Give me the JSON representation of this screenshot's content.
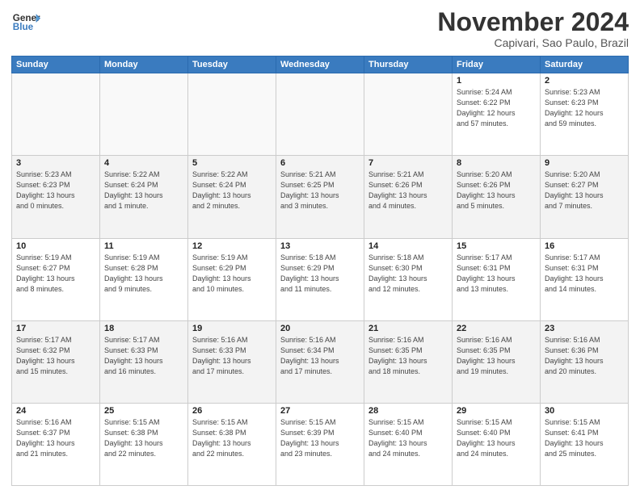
{
  "header": {
    "logo_line1": "General",
    "logo_line2": "Blue",
    "month": "November 2024",
    "location": "Capivari, Sao Paulo, Brazil"
  },
  "weekdays": [
    "Sunday",
    "Monday",
    "Tuesday",
    "Wednesday",
    "Thursday",
    "Friday",
    "Saturday"
  ],
  "weeks": [
    [
      {
        "day": "",
        "info": ""
      },
      {
        "day": "",
        "info": ""
      },
      {
        "day": "",
        "info": ""
      },
      {
        "day": "",
        "info": ""
      },
      {
        "day": "",
        "info": ""
      },
      {
        "day": "1",
        "info": "Sunrise: 5:24 AM\nSunset: 6:22 PM\nDaylight: 12 hours\nand 57 minutes."
      },
      {
        "day": "2",
        "info": "Sunrise: 5:23 AM\nSunset: 6:23 PM\nDaylight: 12 hours\nand 59 minutes."
      }
    ],
    [
      {
        "day": "3",
        "info": "Sunrise: 5:23 AM\nSunset: 6:23 PM\nDaylight: 13 hours\nand 0 minutes."
      },
      {
        "day": "4",
        "info": "Sunrise: 5:22 AM\nSunset: 6:24 PM\nDaylight: 13 hours\nand 1 minute."
      },
      {
        "day": "5",
        "info": "Sunrise: 5:22 AM\nSunset: 6:24 PM\nDaylight: 13 hours\nand 2 minutes."
      },
      {
        "day": "6",
        "info": "Sunrise: 5:21 AM\nSunset: 6:25 PM\nDaylight: 13 hours\nand 3 minutes."
      },
      {
        "day": "7",
        "info": "Sunrise: 5:21 AM\nSunset: 6:26 PM\nDaylight: 13 hours\nand 4 minutes."
      },
      {
        "day": "8",
        "info": "Sunrise: 5:20 AM\nSunset: 6:26 PM\nDaylight: 13 hours\nand 5 minutes."
      },
      {
        "day": "9",
        "info": "Sunrise: 5:20 AM\nSunset: 6:27 PM\nDaylight: 13 hours\nand 7 minutes."
      }
    ],
    [
      {
        "day": "10",
        "info": "Sunrise: 5:19 AM\nSunset: 6:27 PM\nDaylight: 13 hours\nand 8 minutes."
      },
      {
        "day": "11",
        "info": "Sunrise: 5:19 AM\nSunset: 6:28 PM\nDaylight: 13 hours\nand 9 minutes."
      },
      {
        "day": "12",
        "info": "Sunrise: 5:19 AM\nSunset: 6:29 PM\nDaylight: 13 hours\nand 10 minutes."
      },
      {
        "day": "13",
        "info": "Sunrise: 5:18 AM\nSunset: 6:29 PM\nDaylight: 13 hours\nand 11 minutes."
      },
      {
        "day": "14",
        "info": "Sunrise: 5:18 AM\nSunset: 6:30 PM\nDaylight: 13 hours\nand 12 minutes."
      },
      {
        "day": "15",
        "info": "Sunrise: 5:17 AM\nSunset: 6:31 PM\nDaylight: 13 hours\nand 13 minutes."
      },
      {
        "day": "16",
        "info": "Sunrise: 5:17 AM\nSunset: 6:31 PM\nDaylight: 13 hours\nand 14 minutes."
      }
    ],
    [
      {
        "day": "17",
        "info": "Sunrise: 5:17 AM\nSunset: 6:32 PM\nDaylight: 13 hours\nand 15 minutes."
      },
      {
        "day": "18",
        "info": "Sunrise: 5:17 AM\nSunset: 6:33 PM\nDaylight: 13 hours\nand 16 minutes."
      },
      {
        "day": "19",
        "info": "Sunrise: 5:16 AM\nSunset: 6:33 PM\nDaylight: 13 hours\nand 17 minutes."
      },
      {
        "day": "20",
        "info": "Sunrise: 5:16 AM\nSunset: 6:34 PM\nDaylight: 13 hours\nand 17 minutes."
      },
      {
        "day": "21",
        "info": "Sunrise: 5:16 AM\nSunset: 6:35 PM\nDaylight: 13 hours\nand 18 minutes."
      },
      {
        "day": "22",
        "info": "Sunrise: 5:16 AM\nSunset: 6:35 PM\nDaylight: 13 hours\nand 19 minutes."
      },
      {
        "day": "23",
        "info": "Sunrise: 5:16 AM\nSunset: 6:36 PM\nDaylight: 13 hours\nand 20 minutes."
      }
    ],
    [
      {
        "day": "24",
        "info": "Sunrise: 5:16 AM\nSunset: 6:37 PM\nDaylight: 13 hours\nand 21 minutes."
      },
      {
        "day": "25",
        "info": "Sunrise: 5:15 AM\nSunset: 6:38 PM\nDaylight: 13 hours\nand 22 minutes."
      },
      {
        "day": "26",
        "info": "Sunrise: 5:15 AM\nSunset: 6:38 PM\nDaylight: 13 hours\nand 22 minutes."
      },
      {
        "day": "27",
        "info": "Sunrise: 5:15 AM\nSunset: 6:39 PM\nDaylight: 13 hours\nand 23 minutes."
      },
      {
        "day": "28",
        "info": "Sunrise: 5:15 AM\nSunset: 6:40 PM\nDaylight: 13 hours\nand 24 minutes."
      },
      {
        "day": "29",
        "info": "Sunrise: 5:15 AM\nSunset: 6:40 PM\nDaylight: 13 hours\nand 24 minutes."
      },
      {
        "day": "30",
        "info": "Sunrise: 5:15 AM\nSunset: 6:41 PM\nDaylight: 13 hours\nand 25 minutes."
      }
    ]
  ]
}
